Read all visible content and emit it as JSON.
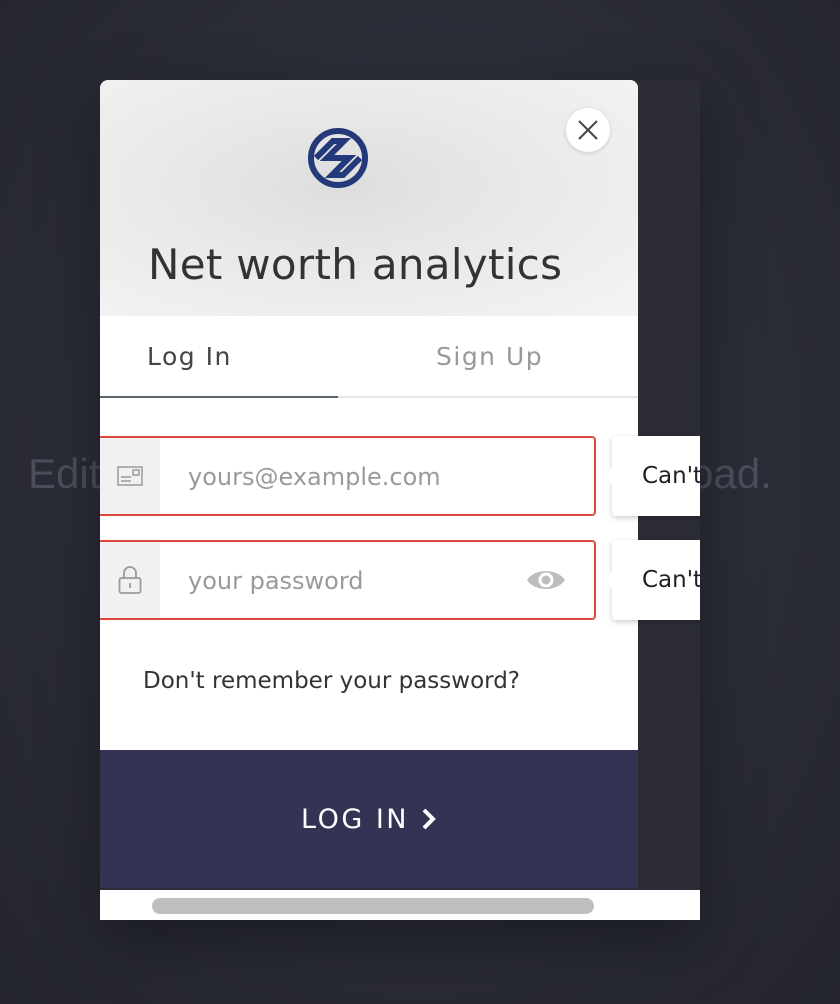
{
  "background": {
    "text_left": "Edit",
    "text_right": "oad."
  },
  "header": {
    "title": "Net worth analytics",
    "logo": "brand-logo-icon",
    "close_icon": "close-icon"
  },
  "tabs": [
    {
      "label": "Log In",
      "active": true
    },
    {
      "label": "Sign Up",
      "active": false
    }
  ],
  "form": {
    "email": {
      "placeholder": "yours@example.com",
      "value": "",
      "icon": "envelope-icon",
      "error_tooltip": "Can't"
    },
    "password": {
      "placeholder": "your password",
      "value": "",
      "icon": "lock-icon",
      "toggle_icon": "eye-icon",
      "error_tooltip": "Can't"
    },
    "forgot_link": "Don't remember your password?",
    "submit_label": "LOG IN"
  },
  "colors": {
    "accent": "#333353",
    "error": "#d9483b",
    "logo": "#23397a"
  }
}
